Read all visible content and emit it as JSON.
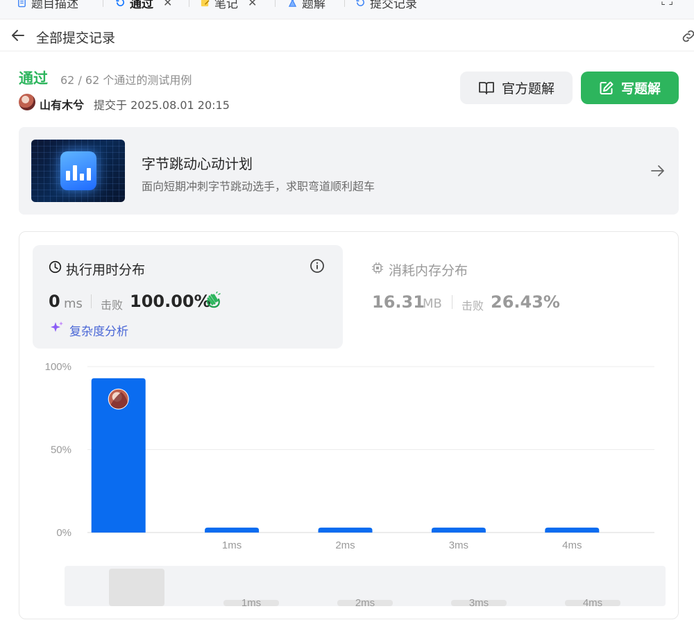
{
  "tabs": [
    {
      "label": "题目描述",
      "icon": "document-icon",
      "closable": false,
      "active": false
    },
    {
      "label": "通过",
      "icon": "history-icon",
      "closable": true,
      "active": true
    },
    {
      "label": "笔记",
      "icon": "note-icon",
      "closable": true,
      "active": false
    },
    {
      "label": "题解",
      "icon": "flask-icon",
      "closable": false,
      "active": false
    },
    {
      "label": "提交记录",
      "icon": "history-icon",
      "closable": false,
      "active": false
    }
  ],
  "header": {
    "title": "全部提交记录"
  },
  "submission": {
    "status": "通过",
    "testcases": "62 / 62 个通过的测试用例",
    "username": "山有木兮",
    "submitted_text": "提交于 2025.08.01 20:15"
  },
  "buttons": {
    "official": "官方题解",
    "write": "写题解"
  },
  "promo": {
    "title": "字节跳动心动计划",
    "subtitle": "面向短期冲刺字节跳动选手，求职弯道顺利超车"
  },
  "runtime": {
    "title": "执行用时分布",
    "value": "0",
    "unit": "ms",
    "beats_label": "击败",
    "beats": "100.00%",
    "complexity_link": "复杂度分析"
  },
  "memory": {
    "title": "消耗内存分布",
    "value": "16.31",
    "unit": "MB",
    "beats_label": "击败",
    "beats": "26.43%"
  },
  "colors": {
    "accent_green": "#2db55d",
    "bar_blue": "#0a6cf0",
    "link_blue": "#4a67d6"
  },
  "chart_data": {
    "type": "bar",
    "categories": [
      "0ms",
      "1ms",
      "2ms",
      "3ms",
      "4ms"
    ],
    "tick_labels": [
      "",
      "1ms",
      "2ms",
      "3ms",
      "4ms"
    ],
    "values": [
      93,
      3,
      3,
      3,
      3
    ],
    "ylim": [
      0,
      100
    ],
    "yticks": [
      "0%",
      "50%",
      "100%"
    ],
    "ytick_values": [
      0,
      50,
      100
    ],
    "grid": true,
    "highlight_index": 0,
    "overview_labels": [
      "1ms",
      "2ms",
      "3ms",
      "4ms"
    ]
  }
}
